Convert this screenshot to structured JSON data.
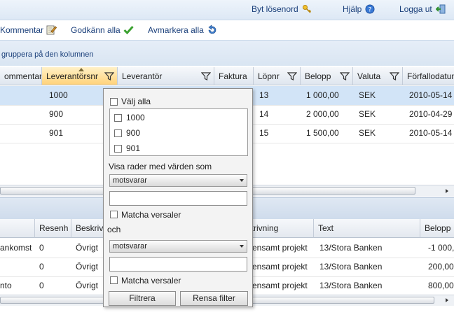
{
  "header": {
    "change_password": "Byt lösenord",
    "help": "Hjälp",
    "logout": "Logga ut"
  },
  "toolbar": {
    "comment": "Kommentar",
    "approve_all": "Godkänn alla",
    "unmark_all": "Avmarkera alla"
  },
  "group_panel": {
    "hint": "gruppera på den kolumnen"
  },
  "grid": {
    "columns": [
      "ommentar",
      "Leverantörsnr",
      "Leverantör",
      "Faktura",
      "Löpnr",
      "Belopp",
      "Valuta",
      "Förfallodatum"
    ],
    "rows": [
      {
        "supplier_no": "1000",
        "serial": "13",
        "amount": "1 000,00",
        "currency": "SEK",
        "due": "2010-05-14"
      },
      {
        "supplier_no": "900",
        "serial": "14",
        "amount": "2 000,00",
        "currency": "SEK",
        "due": "2010-04-29"
      },
      {
        "supplier_no": "901",
        "serial": "15",
        "amount": "1 500,00",
        "currency": "SEK",
        "due": "2010-05-14"
      }
    ]
  },
  "detail_grid": {
    "columns": [
      "",
      "Resenh",
      "Beskrivn",
      "skrivning",
      "Text",
      "Belopp"
    ],
    "rows": [
      {
        "c0": "ankomst",
        "c1": "0",
        "c2": "Övrigt",
        "c3": "mensamt projekt",
        "c4": "13/Stora Banken",
        "c5": "-1 000,"
      },
      {
        "c0": "",
        "c1": "0",
        "c2": "Övrigt",
        "c3": "mensamt projekt",
        "c4": "13/Stora Banken",
        "c5": "200,00"
      },
      {
        "c0": "nto",
        "c1": "0",
        "c2": "Övrigt",
        "c3": "mensamt projekt",
        "c4": "13/Stora Banken",
        "c5": "800,00"
      }
    ]
  },
  "filter": {
    "select_all": "Välj alla",
    "options": [
      "1000",
      "900",
      "901"
    ],
    "show_rows": "Visa rader med värden som",
    "operator1": "motsvarar",
    "match_case": "Matcha versaler",
    "and": "och",
    "operator2": "motsvarar",
    "filter_button": "Filtrera",
    "clear_button": "Rensa filter"
  }
}
